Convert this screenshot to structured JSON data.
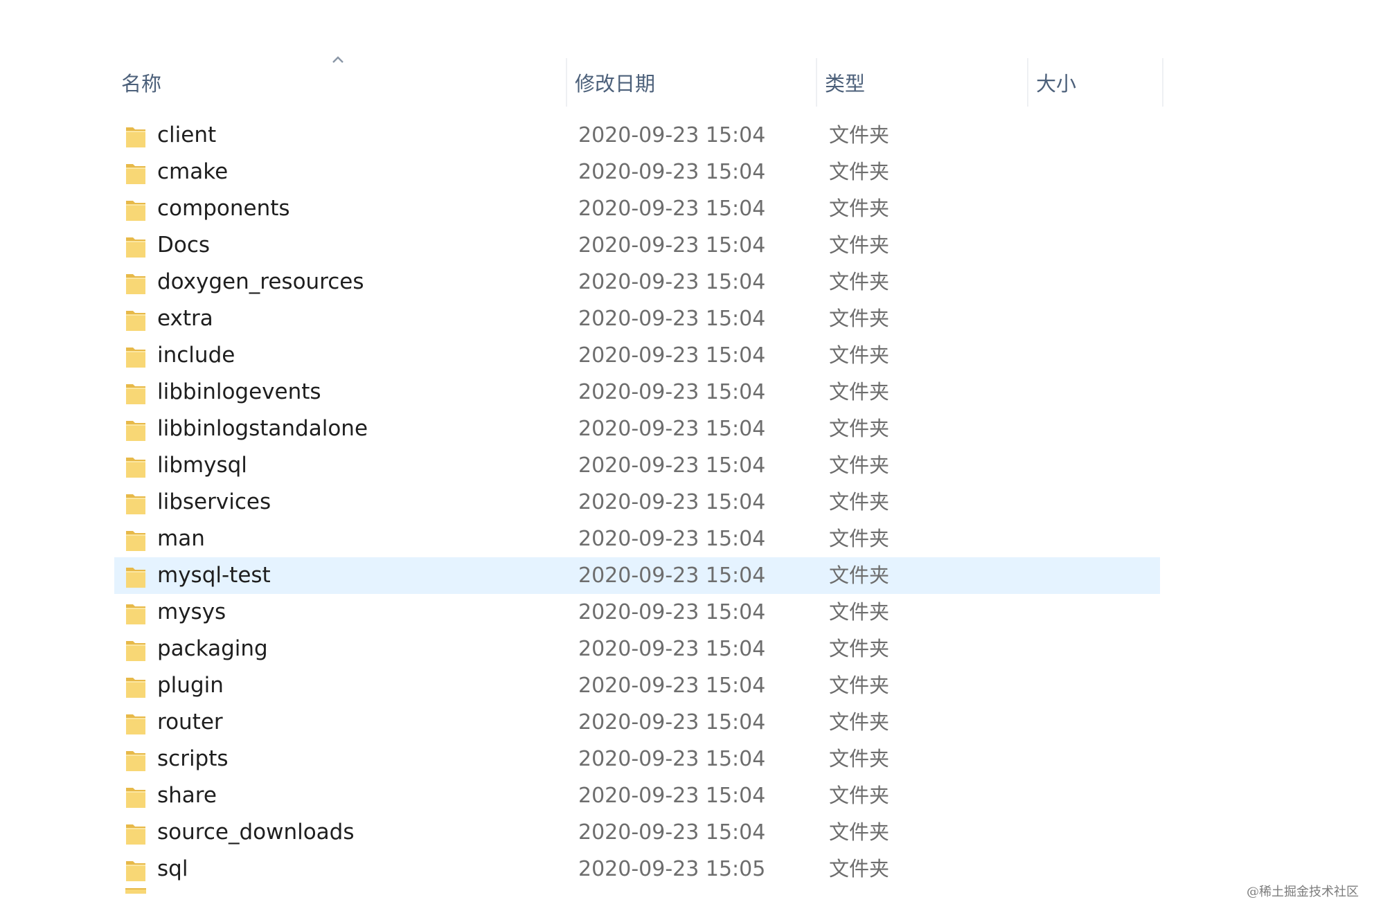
{
  "columns": {
    "name": "名称",
    "date_modified": "修改日期",
    "type": "类型",
    "size": "大小"
  },
  "sort": {
    "column": "name",
    "direction": "ascending",
    "icon": "chevron-up-icon"
  },
  "colors": {
    "selected_row": "#e5f3ff",
    "folder_body": "#f8d775",
    "folder_tab": "#e7b949"
  },
  "folders": [
    {
      "name": "client",
      "date": "2020-09-23 15:04",
      "type": "文件夹",
      "size": ""
    },
    {
      "name": "cmake",
      "date": "2020-09-23 15:04",
      "type": "文件夹",
      "size": ""
    },
    {
      "name": "components",
      "date": "2020-09-23 15:04",
      "type": "文件夹",
      "size": ""
    },
    {
      "name": "Docs",
      "date": "2020-09-23 15:04",
      "type": "文件夹",
      "size": ""
    },
    {
      "name": "doxygen_resources",
      "date": "2020-09-23 15:04",
      "type": "文件夹",
      "size": ""
    },
    {
      "name": "extra",
      "date": "2020-09-23 15:04",
      "type": "文件夹",
      "size": ""
    },
    {
      "name": "include",
      "date": "2020-09-23 15:04",
      "type": "文件夹",
      "size": ""
    },
    {
      "name": "libbinlogevents",
      "date": "2020-09-23 15:04",
      "type": "文件夹",
      "size": ""
    },
    {
      "name": "libbinlogstandalone",
      "date": "2020-09-23 15:04",
      "type": "文件夹",
      "size": ""
    },
    {
      "name": "libmysql",
      "date": "2020-09-23 15:04",
      "type": "文件夹",
      "size": ""
    },
    {
      "name": "libservices",
      "date": "2020-09-23 15:04",
      "type": "文件夹",
      "size": ""
    },
    {
      "name": "man",
      "date": "2020-09-23 15:04",
      "type": "文件夹",
      "size": ""
    },
    {
      "name": "mysql-test",
      "date": "2020-09-23 15:04",
      "type": "文件夹",
      "size": "",
      "selected": true
    },
    {
      "name": "mysys",
      "date": "2020-09-23 15:04",
      "type": "文件夹",
      "size": ""
    },
    {
      "name": "packaging",
      "date": "2020-09-23 15:04",
      "type": "文件夹",
      "size": ""
    },
    {
      "name": "plugin",
      "date": "2020-09-23 15:04",
      "type": "文件夹",
      "size": ""
    },
    {
      "name": "router",
      "date": "2020-09-23 15:04",
      "type": "文件夹",
      "size": ""
    },
    {
      "name": "scripts",
      "date": "2020-09-23 15:04",
      "type": "文件夹",
      "size": ""
    },
    {
      "name": "share",
      "date": "2020-09-23 15:04",
      "type": "文件夹",
      "size": ""
    },
    {
      "name": "source_downloads",
      "date": "2020-09-23 15:04",
      "type": "文件夹",
      "size": ""
    },
    {
      "name": "sql",
      "date": "2020-09-23 15:05",
      "type": "文件夹",
      "size": ""
    }
  ],
  "watermark": "@稀土掘金技术社区"
}
